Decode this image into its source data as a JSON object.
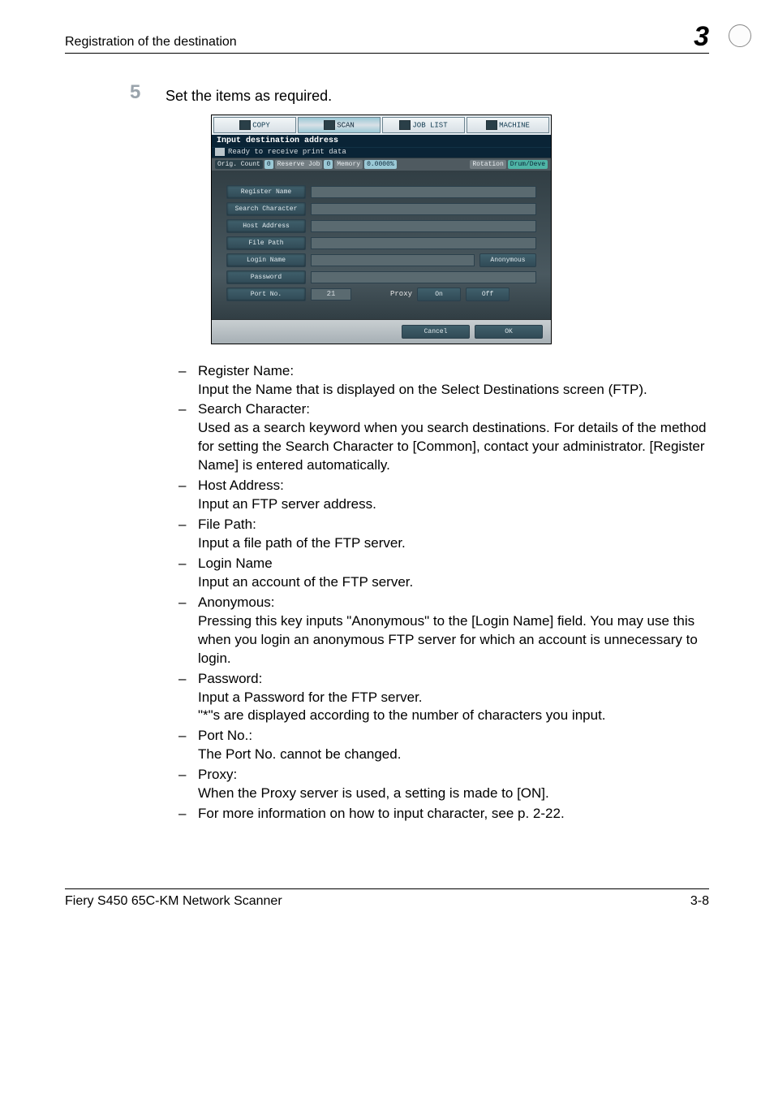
{
  "header": {
    "title": "Registration of the destination",
    "chapter_number": "3"
  },
  "step": {
    "number": "5",
    "text": "Set the items as required."
  },
  "dialog": {
    "tabs": [
      "COPY",
      "SCAN",
      "JOB LIST",
      "MACHINE"
    ],
    "active_tab_index": 1,
    "title": "Input destination address",
    "status": "Ready to receive print data",
    "bar": {
      "orig_count": "Orig. Count",
      "orig_count_val": "0",
      "reserve": "Reserve Job",
      "memory": "Memory",
      "memory_val": "0",
      "percent": "0.0000%",
      "rotation": "Rotation",
      "drum": "Drum/Deve"
    },
    "fields": {
      "register_name": "Register Name",
      "search_character": "Search Character",
      "host_address": "Host Address",
      "file_path": "File Path",
      "login_name": "Login Name",
      "password": "Password",
      "port_no": "Port No.",
      "port_no_value": "21",
      "proxy_label": "Proxy",
      "on": "On",
      "off": "Off",
      "anonymous": "Anonymous"
    },
    "buttons": {
      "cancel": "Cancel",
      "ok": "OK"
    }
  },
  "items": {
    "register_name_title": "Register Name:",
    "register_name_body": "Input the Name that is displayed on the Select Destinations screen (FTP).",
    "search_char_title": "Search Character:",
    "search_char_body": "Used as a search keyword when you search destinations. For details of the method for setting the Search Character to [Common], contact your administrator. [Register Name] is entered automatically.",
    "host_address_title": "Host Address:",
    "host_address_body": "Input an FTP server address.",
    "file_path_title": "File Path:",
    "file_path_body": "Input a file path of the FTP server.",
    "login_name_title": "Login Name",
    "login_name_body": "Input an account of the FTP server.",
    "anonymous_title": "Anonymous:",
    "anonymous_body": "Pressing this key inputs \"Anonymous\" to the [Login Name] field. You may use this when you login an anonymous FTP server for which an account is unnecessary to login.",
    "password_title": "Password:",
    "password_body1": "Input a Password for the FTP server.",
    "password_body2": "\"*\"s are displayed according to the number of characters you input.",
    "port_no_title": "Port No.:",
    "port_no_body": "The Port No. cannot be changed.",
    "proxy_title": "Proxy:",
    "proxy_body": "When the Proxy server is used, a setting is made to [ON].",
    "more_info": "For more information on how to input character, see p. 2-22."
  },
  "footer": {
    "left": "Fiery S450 65C-KM Network Scanner",
    "right": "3-8"
  }
}
